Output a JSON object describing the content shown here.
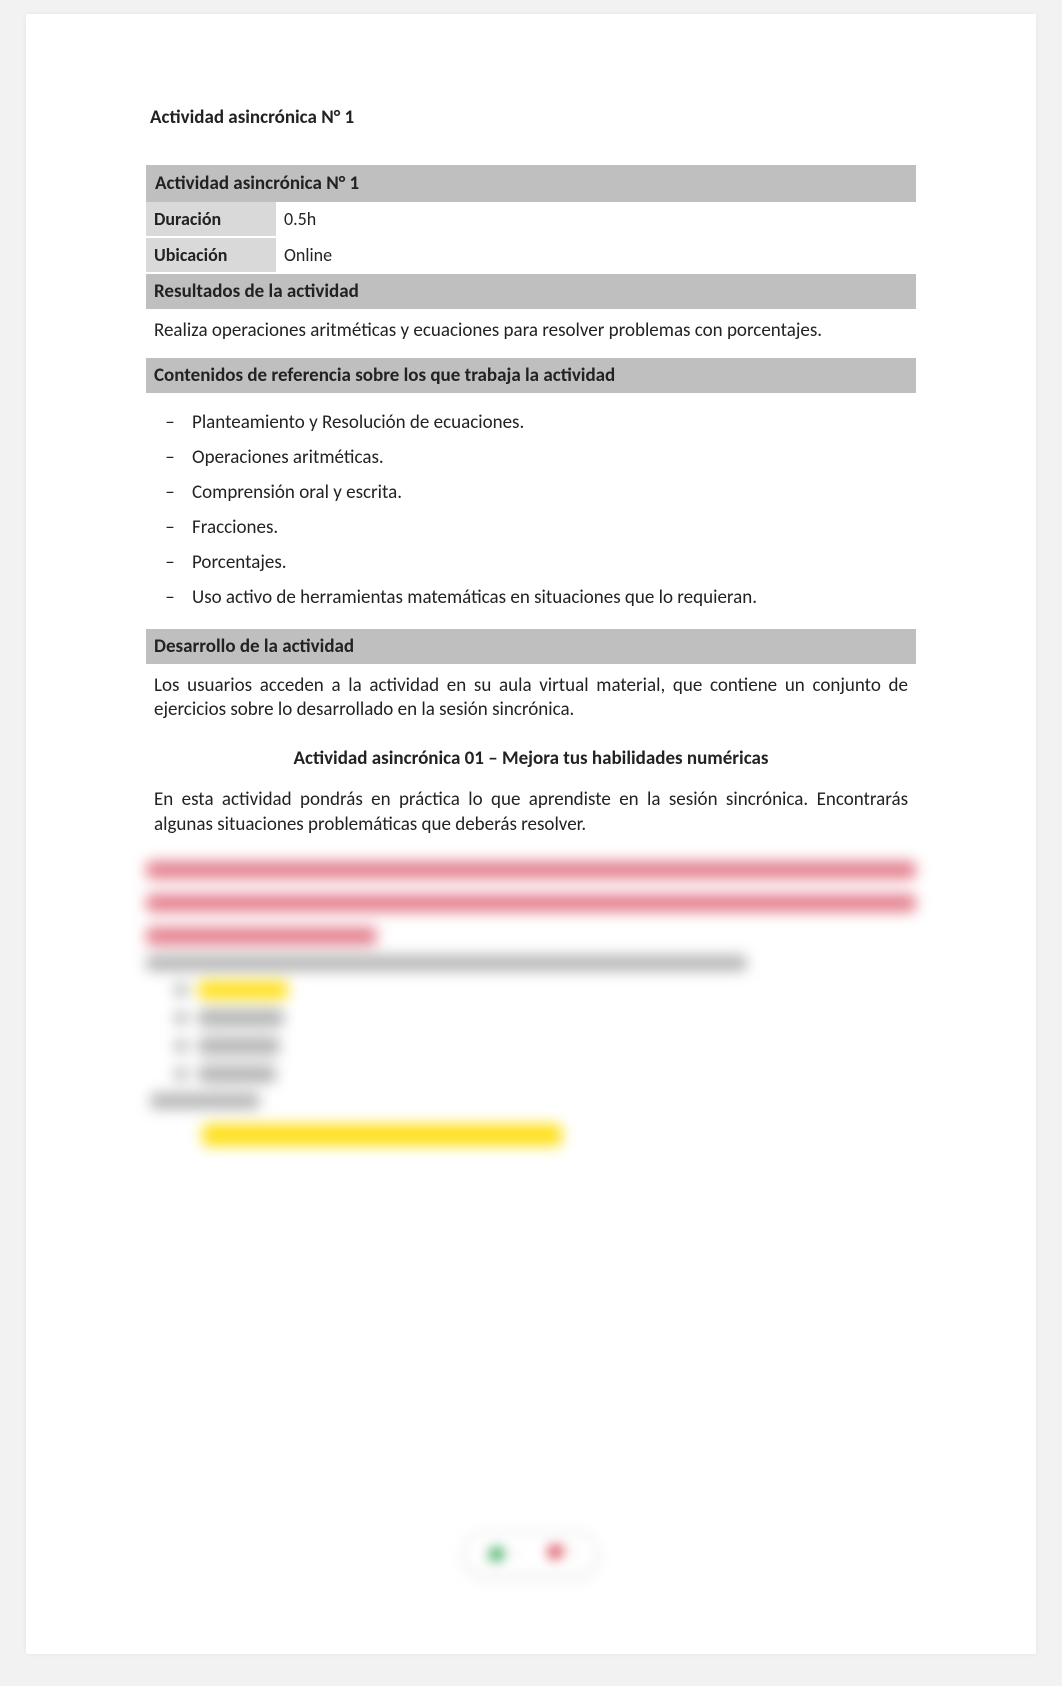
{
  "title": "Actividad asincrónica N° 1",
  "table_title": "Actividad asincrónica N° 1",
  "rows": {
    "duracion_label": "Duración",
    "duracion_value": "0.5h",
    "ubicacion_label": "Ubicación",
    "ubicacion_value": "Online"
  },
  "resultados_header": "Resultados de la actividad",
  "resultados_text": "Realiza operaciones aritméticas y ecuaciones para resolver problemas con porcentajes.",
  "contenidos_header": "Contenidos de referencia sobre los que trabaja la actividad",
  "contenidos_items": [
    "Planteamiento y Resolución de ecuaciones.",
    "Operaciones aritméticas.",
    "Comprensión oral y escrita.",
    "Fracciones.",
    "Porcentajes.",
    "Uso activo de herramientas matemáticas en situaciones que lo requieran."
  ],
  "desarrollo_header": "Desarrollo de la actividad",
  "desarrollo_text": "Los usuarios acceden a la actividad en su aula virtual material, que contiene un conjunto de ejercicios sobre lo desarrollado en la sesión sincrónica.",
  "sub_title": "Actividad asincrónica 01 – Mejora tus habilidades numéricas",
  "intro_text": "En esta actividad pondrás en práctica lo que aprendiste en la sesión sincrónica. Encontrarás algunas situaciones problemáticas que deberás resolver.",
  "dash": "–"
}
